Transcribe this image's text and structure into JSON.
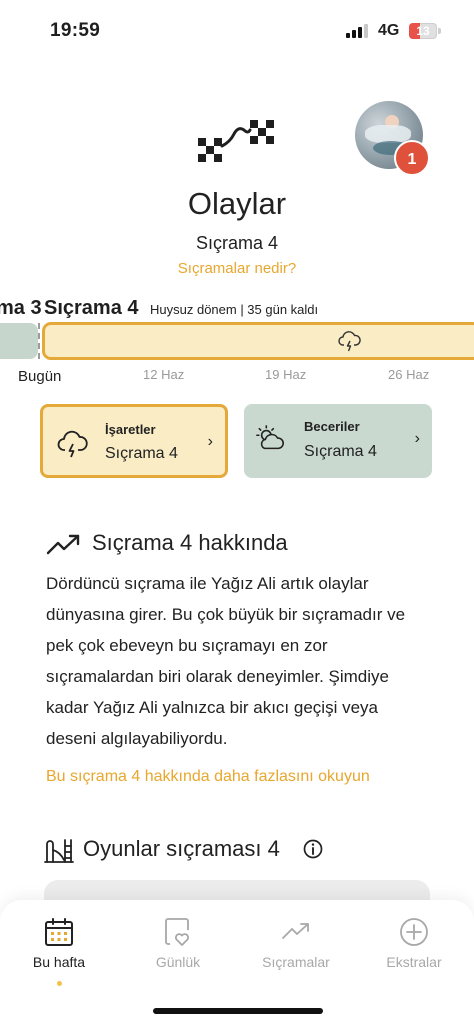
{
  "status_bar": {
    "time": "19:59",
    "network": "4G",
    "battery": "13"
  },
  "header": {
    "title": "Olaylar",
    "subtitle": "Sıçrama 4",
    "link": "Sıçramalar nedir?",
    "notification_count": "1"
  },
  "timeline": {
    "prev_leap_label": "ma 3",
    "current_leap_label": "Sıçrama 4",
    "current_leap_desc": "Huysuz dönem | 35 gün kaldı",
    "today_label": "Bugün",
    "dates": [
      "12 Haz",
      "19 Haz",
      "26 Haz"
    ]
  },
  "cards": [
    {
      "title": "İşaretler",
      "value": "Sıçrama 4",
      "icon": "storm-icon"
    },
    {
      "title": "Beceriler",
      "value": "Sıçrama 4",
      "icon": "sun-cloud-icon"
    }
  ],
  "about": {
    "title": "Sıçrama 4 hakkında",
    "body": "Dördüncü sıçrama ile Yağız Ali artık olaylar dünyasına girer. Bu çok büyük bir sıçramadır ve pek çok ebeveyn bu sıçramayı en zor sıçramalardan biri olarak deneyimler. Şimdiye kadar Yağız Ali yalnızca bir akıcı geçişi veya deseni algılayabiliyordu.",
    "link": "Bu sıçrama 4 hakkında daha fazlasını okuyun"
  },
  "games": {
    "title": "Oyunlar sıçraması 4"
  },
  "bottom_nav": [
    {
      "label": "Bu hafta",
      "icon": "calendar-icon",
      "active": true
    },
    {
      "label": "Günlük",
      "icon": "diary-icon",
      "active": false
    },
    {
      "label": "Sıçramalar",
      "icon": "trend-icon",
      "active": false
    },
    {
      "label": "Ekstralar",
      "icon": "plus-circle-icon",
      "active": false
    }
  ],
  "colors": {
    "accent": "#e8a72e",
    "card_yellow": "#faedc6",
    "card_green": "#c9d9d0",
    "badge": "#e0513c"
  }
}
